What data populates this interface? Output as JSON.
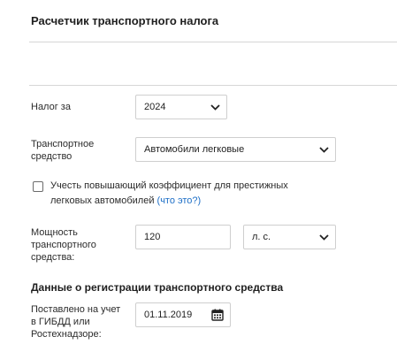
{
  "title": "Расчетчик транспортного налога",
  "tax_year": {
    "label": "Налог за",
    "value": "2024"
  },
  "vehicle": {
    "label_line1": "Транспортное",
    "label_line2": "средство",
    "value": "Автомобили легковые"
  },
  "prestige": {
    "checked": false,
    "text_line1": "Учесть повышающий коэффициент для престижных",
    "text_line2": "легковых автомобилей",
    "link": "(что это?)"
  },
  "power": {
    "label_line1": "Мощность",
    "label_line2": "транспортного",
    "label_line3": "средства:",
    "value": "120",
    "unit": "л. с."
  },
  "registration": {
    "section_title": "Данные о регистрации транспортного средства",
    "label_line1": "Поставлено на учет",
    "label_line2": "в ГИБДД или",
    "label_line3": "Ростехнадзоре:",
    "date": "01.11.2019"
  }
}
